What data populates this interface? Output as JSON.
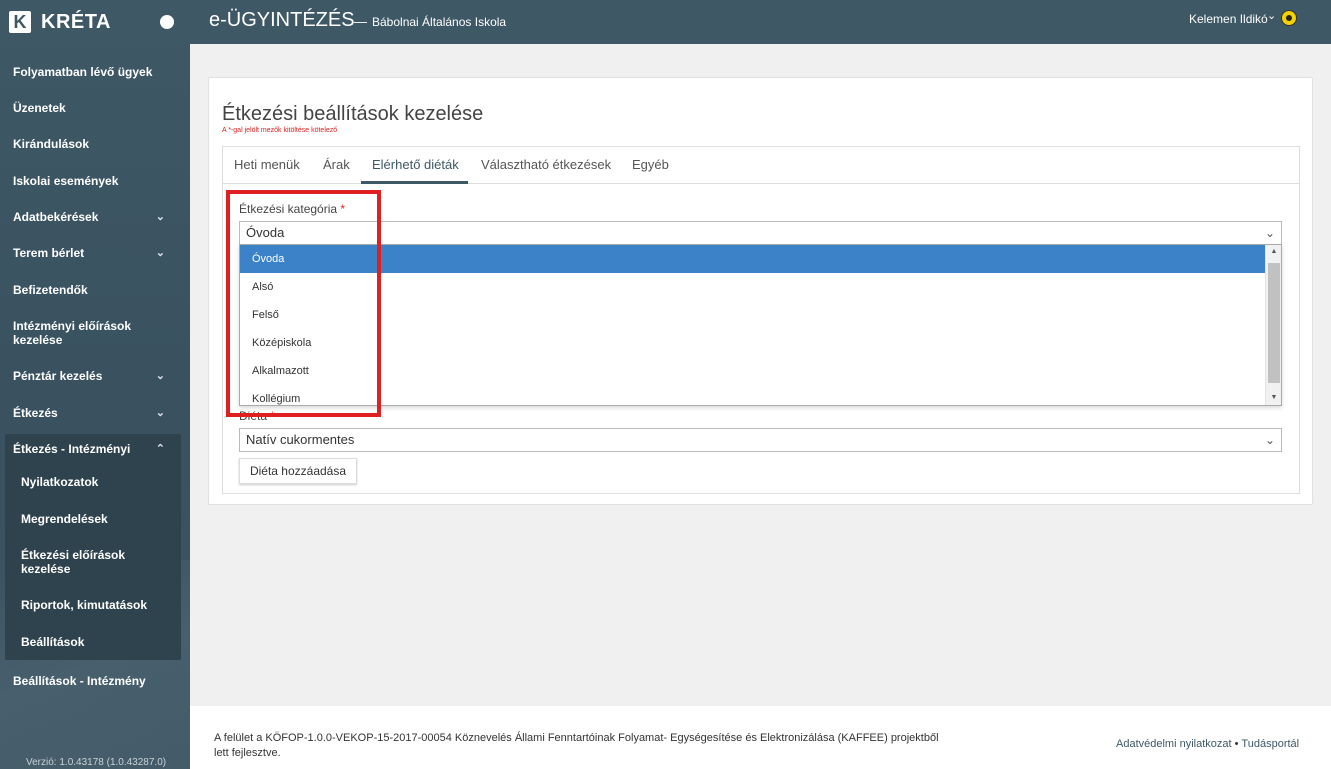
{
  "brand": {
    "logo_letter": "K",
    "name": "KRÉTA"
  },
  "sidebar": {
    "items": [
      {
        "label": "Folyamatban lévő ügyek",
        "chevron": ""
      },
      {
        "label": "Üzenetek",
        "chevron": ""
      },
      {
        "label": "Kirándulások",
        "chevron": ""
      },
      {
        "label": "Iskolai események",
        "chevron": ""
      },
      {
        "label": "Adatbekérések",
        "chevron": "⌄"
      },
      {
        "label": "Terem bérlet",
        "chevron": "⌄"
      },
      {
        "label": "Befizetendők",
        "chevron": ""
      },
      {
        "label": "Intézményi előírások kezelése",
        "chevron": ""
      },
      {
        "label": "Pénztár kezelés",
        "chevron": "⌄"
      },
      {
        "label": "Étkezés",
        "chevron": "⌄"
      },
      {
        "label": "Étkezés - Intézményi",
        "chevron": "⌃"
      },
      {
        "label": "Beállítások - Intézmény",
        "chevron": ""
      }
    ],
    "sub_items": [
      {
        "label": "Nyilatkozatok"
      },
      {
        "label": "Megrendelések"
      },
      {
        "label": "Étkezési előírások kezelése"
      },
      {
        "label": "Riportok, kimutatások"
      },
      {
        "label": "Beállítások"
      }
    ],
    "version": "Verzió: 1.0.43178 (1.0.43287.0)"
  },
  "header": {
    "app_title": "e-ÜGYINTÉZÉS",
    "dash": "—",
    "school": "Bábolnai Általános Iskola",
    "user_name": "Kelemen Ildikó",
    "user_chevron": "⌄"
  },
  "main": {
    "title": "Étkezési beállítások kezelése",
    "required_note": "A *-gal jelölt mezők kitöltése kötelező",
    "tabs": [
      {
        "label": "Heti menük"
      },
      {
        "label": "Árak"
      },
      {
        "label": "Elérhető diéták"
      },
      {
        "label": "Választható étkezések"
      },
      {
        "label": "Egyéb"
      }
    ],
    "category_field": {
      "label": "Étkezési kategória",
      "required_mark": "*",
      "value": "Óvoda",
      "options": [
        {
          "label": "Óvoda",
          "selected": true
        },
        {
          "label": "Alsó"
        },
        {
          "label": "Felső"
        },
        {
          "label": "Középiskola"
        },
        {
          "label": "Alkalmazott"
        },
        {
          "label": "Kollégium"
        }
      ]
    },
    "diet_field": {
      "label": "Diéta",
      "required_mark": "*",
      "value": "Natív cukormentes"
    },
    "add_button_label": "Diéta hozzáadása"
  },
  "footer": {
    "text": "A felület a KÖFOP-1.0.0-VEKOP-15-2017-00054 Köznevelés Állami Fenntartóinak Folyamat- Egységesítése és Elektronizálása (KAFFEE) projektből lett fejlesztve.",
    "privacy_link": "Adatvédelmi nyilatkozat",
    "separator": "•",
    "knowledge_link": "Tudásportál"
  },
  "colors": {
    "brand_dark": "#3e5866",
    "selection_blue": "#3c82c8",
    "required_red": "#dd2222",
    "highlight_red": "#e02020"
  }
}
